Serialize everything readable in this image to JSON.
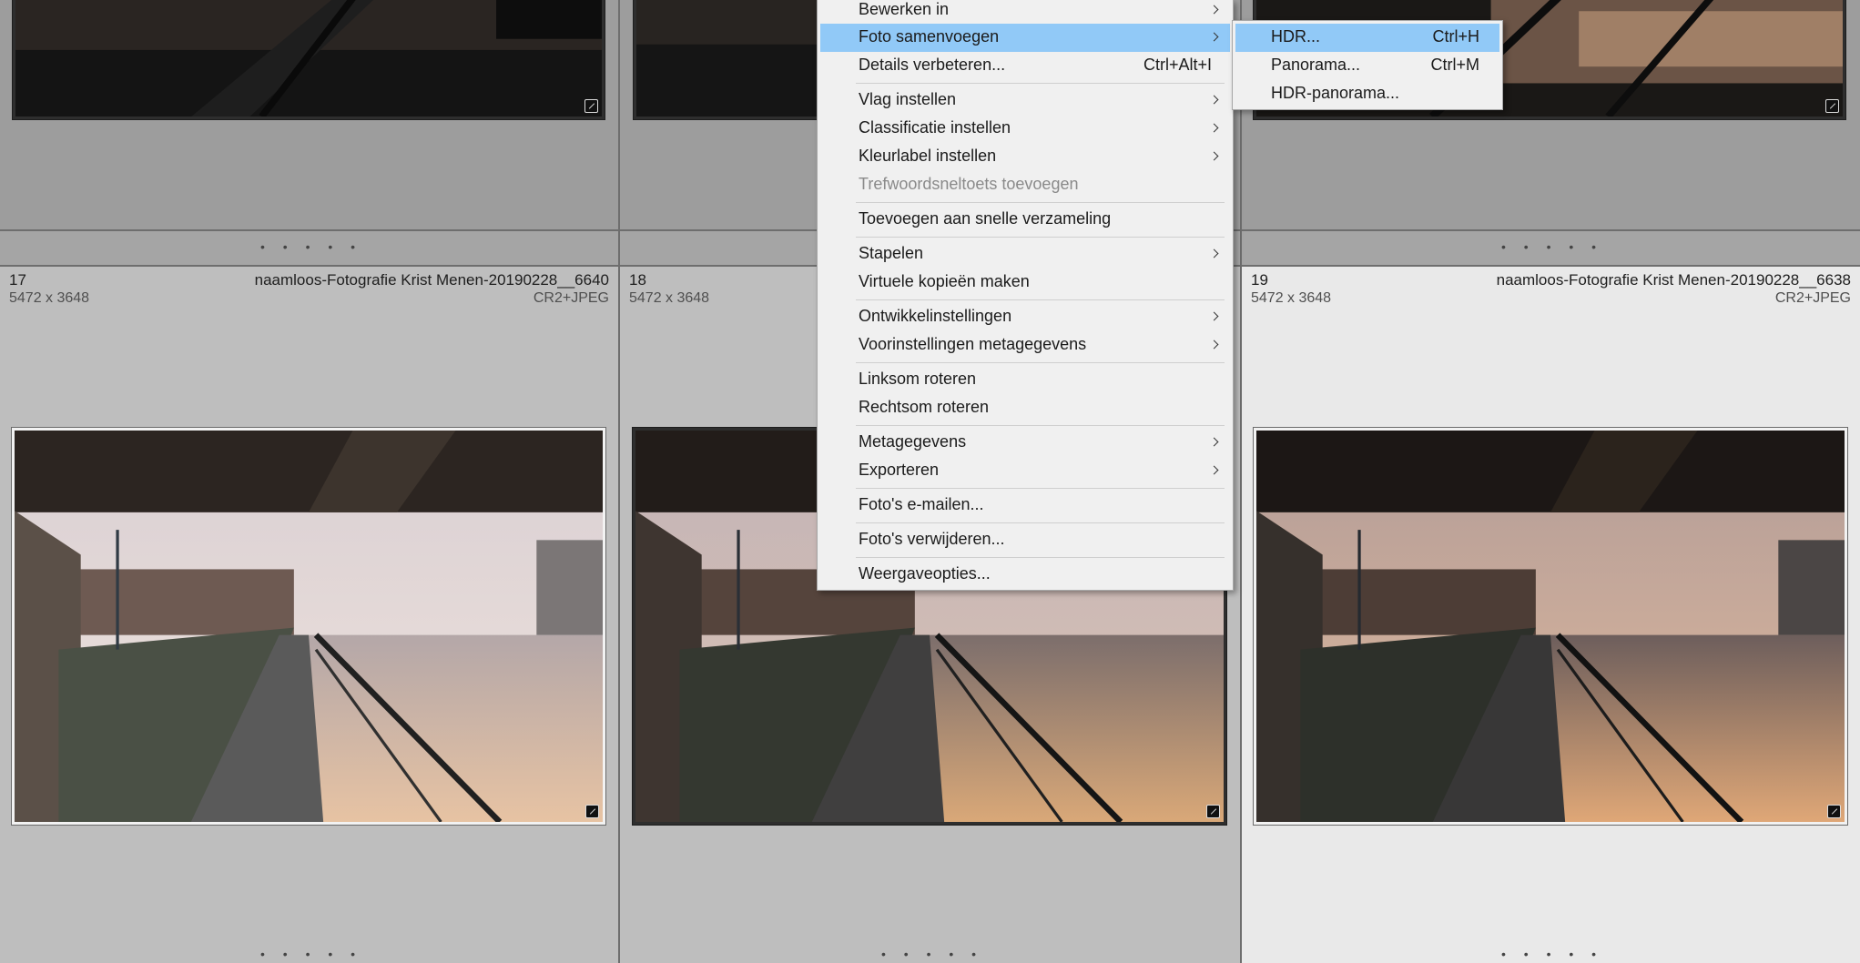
{
  "grid": {
    "cells": [
      {
        "number": "17",
        "filename": "naamloos-Fotografie Krist Menen-20190228__6640",
        "dimensions": "5472 x 3648",
        "file_type": "CR2+JPEG"
      },
      {
        "number": "18",
        "filename": "",
        "dimensions": "5472 x 3648",
        "file_type": ""
      },
      {
        "number": "19",
        "filename": "naamloos-Fotografie Krist Menen-20190228__6638",
        "dimensions": "5472 x 3648",
        "file_type": "CR2+JPEG"
      }
    ],
    "dots": "• • • • •",
    "selected_cell_number": "19"
  },
  "context_menu": {
    "items": [
      {
        "label": "Bewerken in",
        "shortcut": "",
        "submenu": true,
        "disabled": false,
        "highlighted": false
      },
      {
        "label": "Foto samenvoegen",
        "shortcut": "",
        "submenu": true,
        "disabled": false,
        "highlighted": true
      },
      {
        "label": "Details verbeteren...",
        "shortcut": "Ctrl+Alt+I",
        "submenu": false,
        "disabled": false,
        "highlighted": false
      },
      {
        "label": "Vlag instellen",
        "shortcut": "",
        "submenu": true,
        "disabled": false,
        "highlighted": false
      },
      {
        "label": "Classificatie instellen",
        "shortcut": "",
        "submenu": true,
        "disabled": false,
        "highlighted": false
      },
      {
        "label": "Kleurlabel instellen",
        "shortcut": "",
        "submenu": true,
        "disabled": false,
        "highlighted": false
      },
      {
        "label": "Trefwoordsneltoets toevoegen",
        "shortcut": "",
        "submenu": false,
        "disabled": true,
        "highlighted": false
      },
      {
        "label": "Toevoegen aan snelle verzameling",
        "shortcut": "",
        "submenu": false,
        "disabled": false,
        "highlighted": false
      },
      {
        "label": "Stapelen",
        "shortcut": "",
        "submenu": true,
        "disabled": false,
        "highlighted": false
      },
      {
        "label": "Virtuele kopieën maken",
        "shortcut": "",
        "submenu": false,
        "disabled": false,
        "highlighted": false
      },
      {
        "label": "Ontwikkelinstellingen",
        "shortcut": "",
        "submenu": true,
        "disabled": false,
        "highlighted": false
      },
      {
        "label": "Voorinstellingen metagegevens",
        "shortcut": "",
        "submenu": true,
        "disabled": false,
        "highlighted": false
      },
      {
        "label": "Linksom roteren",
        "shortcut": "",
        "submenu": false,
        "disabled": false,
        "highlighted": false
      },
      {
        "label": "Rechtsom roteren",
        "shortcut": "",
        "submenu": false,
        "disabled": false,
        "highlighted": false
      },
      {
        "label": "Metagegevens",
        "shortcut": "",
        "submenu": true,
        "disabled": false,
        "highlighted": false
      },
      {
        "label": "Exporteren",
        "shortcut": "",
        "submenu": true,
        "disabled": false,
        "highlighted": false
      },
      {
        "label": "Foto's e-mailen...",
        "shortcut": "",
        "submenu": false,
        "disabled": false,
        "highlighted": false
      },
      {
        "label": "Foto's verwijderen...",
        "shortcut": "",
        "submenu": false,
        "disabled": false,
        "highlighted": false
      },
      {
        "label": "Weergaveopties...",
        "shortcut": "",
        "submenu": false,
        "disabled": false,
        "highlighted": false
      }
    ]
  },
  "submenu": {
    "items": [
      {
        "label": "HDR...",
        "shortcut": "Ctrl+H",
        "highlighted": true
      },
      {
        "label": "Panorama...",
        "shortcut": "Ctrl+M",
        "highlighted": false
      },
      {
        "label": "HDR-panorama...",
        "shortcut": "",
        "highlighted": false
      }
    ]
  },
  "colors": {
    "highlight": "#91c9f7",
    "menu_background": "#f0f0f0",
    "selected_cell": "#e9e9e9"
  },
  "icons": {
    "submenu_arrow": "chevron-right-icon",
    "thumbnail_badge": "develop-adjusted-badge-icon"
  }
}
